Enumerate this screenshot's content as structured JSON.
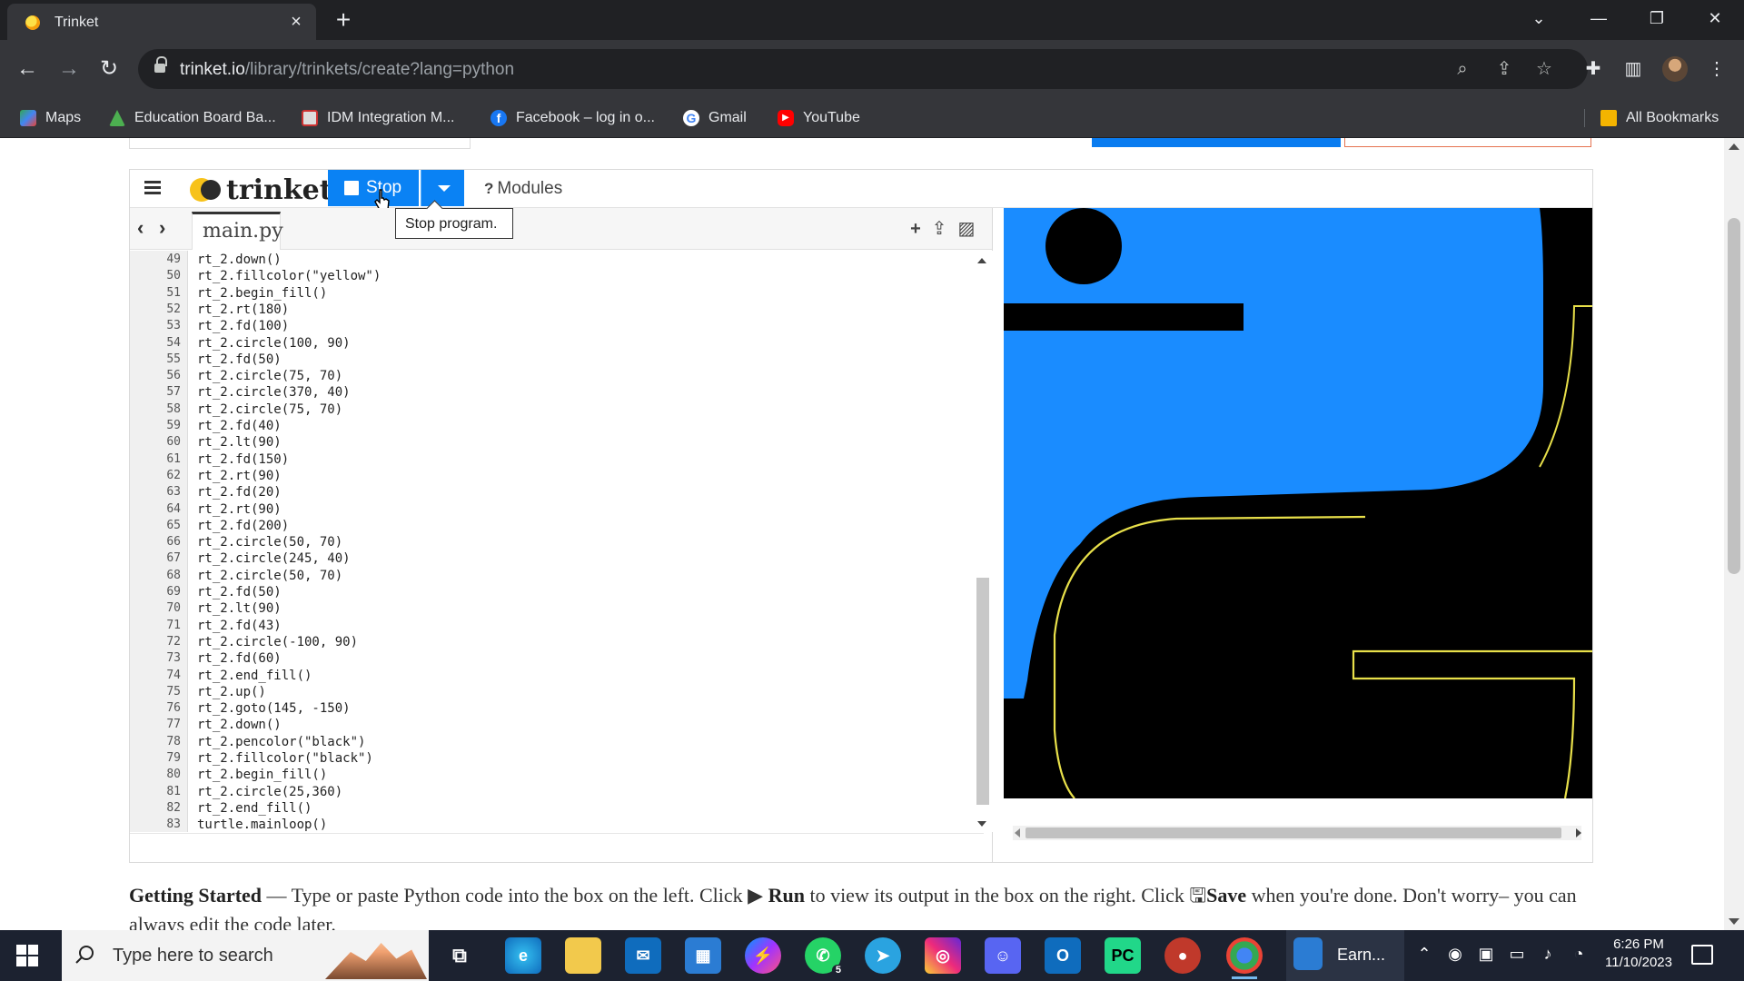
{
  "browser": {
    "tab_title": "Trinket",
    "url_host": "trinket.io",
    "url_path": "/library/trinkets/create?lang=python"
  },
  "bookmarks": [
    {
      "label": "Maps",
      "icon": "maps-icon"
    },
    {
      "label": "Education Board Ba...",
      "icon": "edu-board-icon"
    },
    {
      "label": "IDM Integration M...",
      "icon": "idm-icon"
    },
    {
      "label": "Facebook – log in o...",
      "icon": "facebook-icon"
    },
    {
      "label": "Gmail",
      "icon": "google-icon"
    },
    {
      "label": "YouTube",
      "icon": "youtube-icon"
    }
  ],
  "all_bookmarks": "All Bookmarks",
  "trinket": {
    "logo": "trinket",
    "stop_label": "Stop",
    "modules_label": "Modules",
    "modules_mark": "?",
    "tooltip": "Stop program.",
    "file_tab": "main.py"
  },
  "code": {
    "lines": [
      {
        "n": "49",
        "text": "rt_2.down()"
      },
      {
        "n": "50",
        "text": "rt_2.fillcolor(\"yellow\")"
      },
      {
        "n": "51",
        "text": "rt_2.begin_fill()"
      },
      {
        "n": "52",
        "text": "rt_2.rt(180)"
      },
      {
        "n": "53",
        "text": "rt_2.fd(100)"
      },
      {
        "n": "54",
        "text": "rt_2.circle(100, 90)"
      },
      {
        "n": "55",
        "text": "rt_2.fd(50)"
      },
      {
        "n": "56",
        "text": "rt_2.circle(75, 70)"
      },
      {
        "n": "57",
        "text": "rt_2.circle(370, 40)"
      },
      {
        "n": "58",
        "text": "rt_2.circle(75, 70)"
      },
      {
        "n": "59",
        "text": "rt_2.fd(40)"
      },
      {
        "n": "60",
        "text": "rt_2.lt(90)"
      },
      {
        "n": "61",
        "text": "rt_2.fd(150)"
      },
      {
        "n": "62",
        "text": "rt_2.rt(90)"
      },
      {
        "n": "63",
        "text": "rt_2.fd(20)"
      },
      {
        "n": "64",
        "text": "rt_2.rt(90)"
      },
      {
        "n": "65",
        "text": "rt_2.fd(200)"
      },
      {
        "n": "66",
        "text": "rt_2.circle(50, 70)"
      },
      {
        "n": "67",
        "text": "rt_2.circle(245, 40)"
      },
      {
        "n": "68",
        "text": "rt_2.circle(50, 70)"
      },
      {
        "n": "69",
        "text": "rt_2.fd(50)"
      },
      {
        "n": "70",
        "text": "rt_2.lt(90)"
      },
      {
        "n": "71",
        "text": "rt_2.fd(43)"
      },
      {
        "n": "72",
        "text": "rt_2.circle(-100, 90)"
      },
      {
        "n": "73",
        "text": "rt_2.fd(60)"
      },
      {
        "n": "74",
        "text": "rt_2.end_fill()"
      },
      {
        "n": "75",
        "text": "rt_2.up()"
      },
      {
        "n": "76",
        "text": "rt_2.goto(145, -150)"
      },
      {
        "n": "77",
        "text": "rt_2.down()"
      },
      {
        "n": "78",
        "text": "rt_2.pencolor(\"black\")"
      },
      {
        "n": "79",
        "text": "rt_2.fillcolor(\"black\")"
      },
      {
        "n": "80",
        "text": "rt_2.begin_fill()"
      },
      {
        "n": "81",
        "text": "rt_2.circle(25,360)"
      },
      {
        "n": "82",
        "text": "rt_2.end_fill()"
      },
      {
        "n": "83",
        "text": "turtle.mainloop()"
      }
    ]
  },
  "getting_started": {
    "heading": "Getting Started",
    "dash": " — ",
    "part1": "Type or paste Python code into the box on the left. Click ",
    "run_label": "Run",
    "part2": " to view its output in the box on the right. Click ",
    "save_label": "Save",
    "part3": " when you're done. Don't worry– you can always edit the code later."
  },
  "taskbar": {
    "search_placeholder": "Type here to search",
    "earn_label": "Earn...",
    "whatsapp_badge": "5",
    "time": "6:26 PM",
    "date": "11/10/2023"
  },
  "colors": {
    "trinket_blue": "#0a82f4",
    "python_blue": "#1a8cff",
    "turtle_yellow": "#e8e04a"
  }
}
